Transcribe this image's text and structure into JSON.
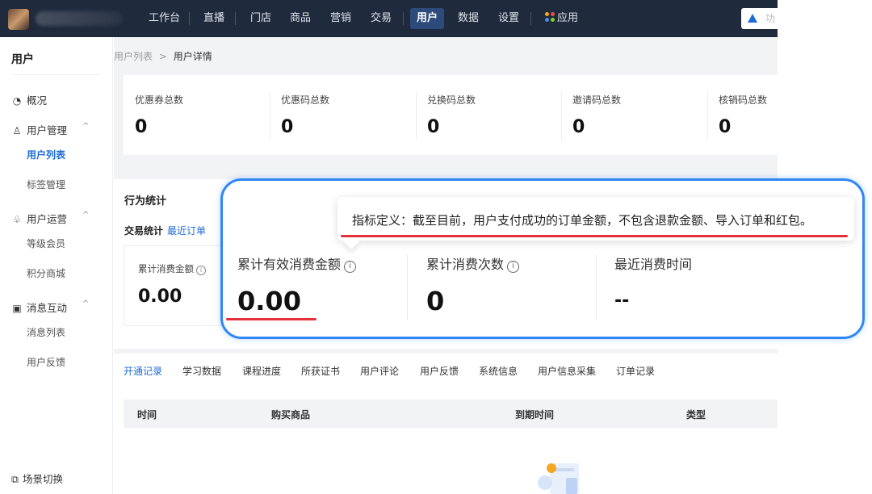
{
  "nav": {
    "items": [
      "工作台",
      "直播",
      "门店",
      "商品",
      "营销",
      "交易",
      "用户",
      "数据",
      "设置",
      "应用"
    ],
    "active": "用户",
    "search_text": "功"
  },
  "sidebar": {
    "title": "用户",
    "overview": "概况",
    "user_management": "用户管理",
    "user_list": "用户列表",
    "tag_management": "标签管理",
    "user_operations": "用户运营",
    "membership_level": "等级会员",
    "points_mall": "积分商城",
    "message_interaction": "消息互动",
    "message_list": "消息列表",
    "user_feedback": "用户反馈",
    "scene_switch": "场景切换"
  },
  "breadcrumb": {
    "parent": "用户列表",
    "separator": ">",
    "current": "用户详情"
  },
  "stats": [
    {
      "label": "优惠券总数",
      "value": "0"
    },
    {
      "label": "优惠码总数",
      "value": "0"
    },
    {
      "label": "兑换码总数",
      "value": "0"
    },
    {
      "label": "邀请码总数",
      "value": "0"
    },
    {
      "label": "核销码总数",
      "value": "0"
    }
  ],
  "behavior": {
    "title": "行为统计",
    "trade_title": "交易统计",
    "recent_orders_link": "最近订单",
    "mini_label": "累计消费金额",
    "mini_value": "0.00"
  },
  "tabs": [
    "开通记录",
    "学习数据",
    "课程进度",
    "所获证书",
    "用户评论",
    "用户反馈",
    "系统信息",
    "用户信息采集",
    "订单记录"
  ],
  "table_headers": [
    "时间",
    "购买商品",
    "到期时间",
    "类型"
  ],
  "callout": {
    "tooltip": "指标定义：截至目前，用户支付成功的订单金额，不包含退款金额、导入订单和红包。",
    "metrics": [
      {
        "label": "累计有效消费金额",
        "value": "0.00"
      },
      {
        "label": "累计消费次数",
        "value": "0"
      },
      {
        "label": "最近消费时间",
        "value": "--"
      }
    ]
  },
  "icons": {
    "info": "i",
    "chevron_up": "^",
    "overview": "◔",
    "user": "♙",
    "operations": "♧",
    "message": "▣",
    "scene": "⧉"
  },
  "colors": {
    "accent": "#1f6bd6",
    "nav_bg": "#1f2a3d",
    "highlight_border": "#2f86f5",
    "underline_red": "#e2313a"
  }
}
